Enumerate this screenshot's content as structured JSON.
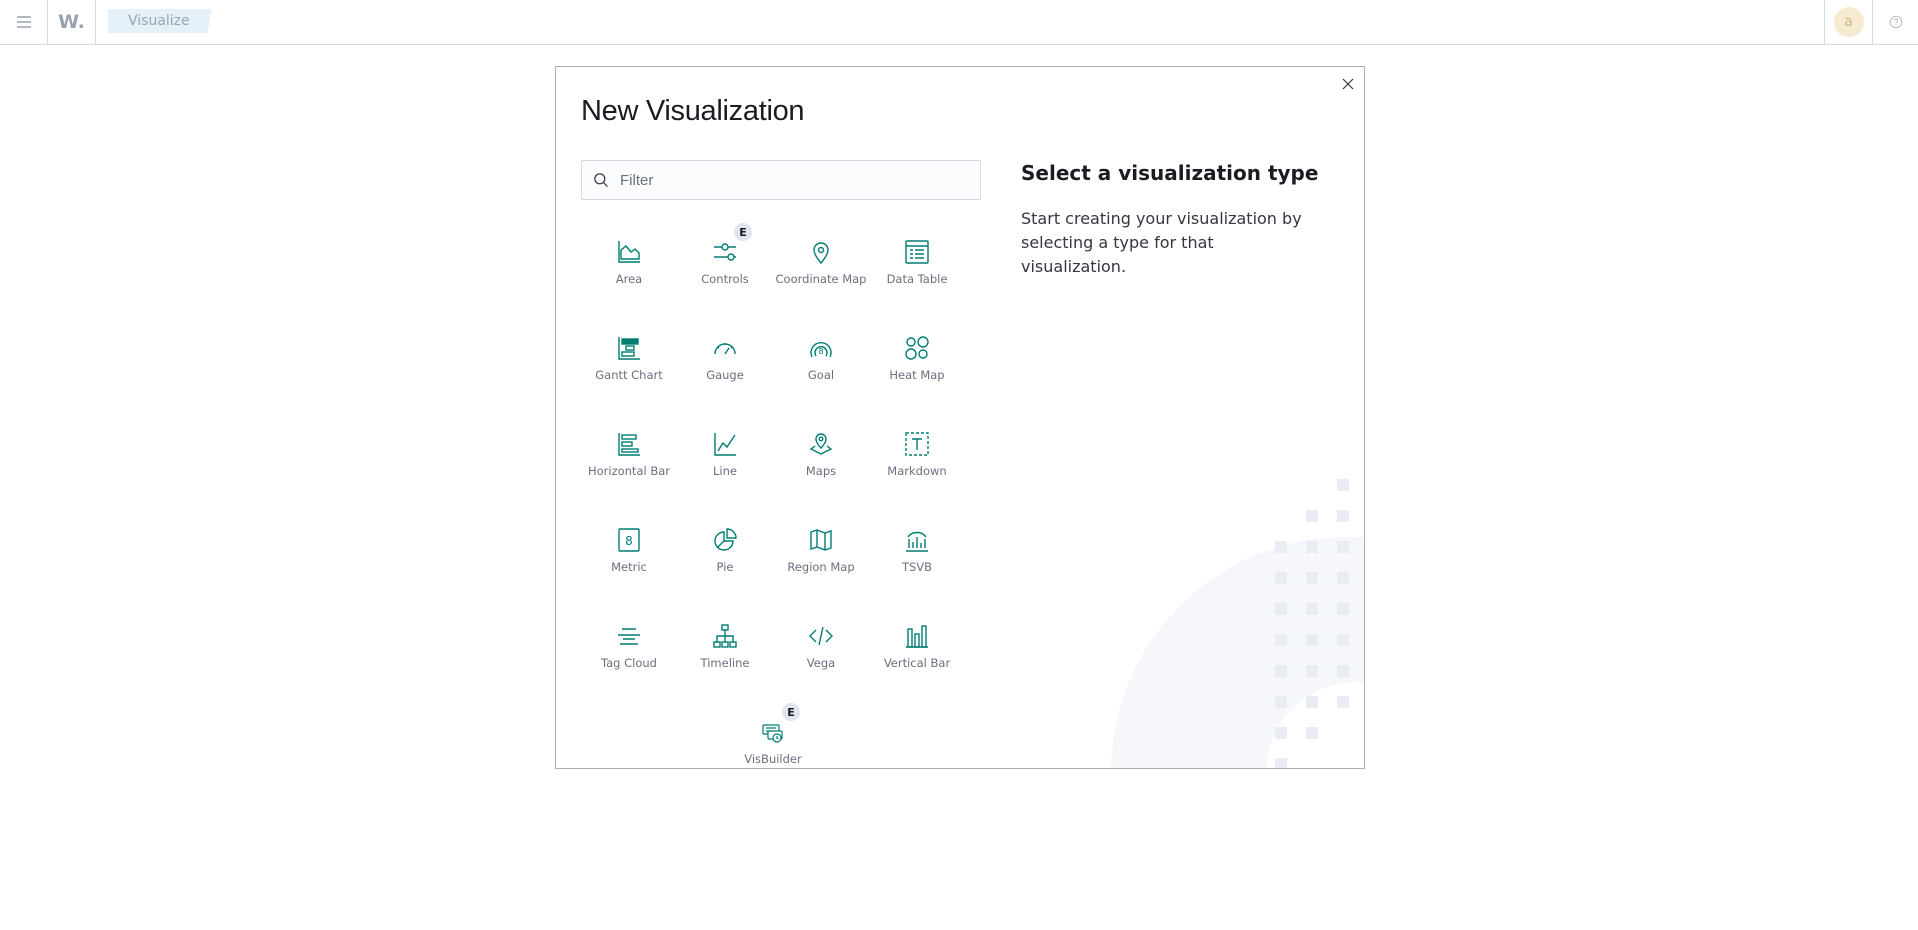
{
  "header": {
    "logo_text": "W.",
    "breadcrumb": "Visualize",
    "avatar_initial": "a",
    "icons": {
      "menu": "hamburger-icon",
      "help": "help-icon"
    }
  },
  "modal": {
    "title": "New Visualization",
    "search_placeholder": "Filter",
    "search_value": "",
    "description_title": "Select a visualization type",
    "description_text": "Start creating your visualization by selecting a type for that visualization.",
    "icons": {
      "close": "close-icon",
      "search": "search-icon"
    },
    "badge_text": "E",
    "types": [
      {
        "label": "Area",
        "icon": "area-chart-icon"
      },
      {
        "label": "Controls",
        "icon": "controls-icon"
      },
      {
        "label": "Coordinate Map",
        "icon": "map-marker-icon"
      },
      {
        "label": "Data Table",
        "icon": "table-icon"
      },
      {
        "label": "Gantt Chart",
        "icon": "gantt-chart-icon"
      },
      {
        "label": "Gauge",
        "icon": "gauge-icon"
      },
      {
        "label": "Goal",
        "icon": "goal-icon"
      },
      {
        "label": "Heat Map",
        "icon": "heat-map-icon"
      },
      {
        "label": "Horizontal Bar",
        "icon": "horizontal-bar-icon"
      },
      {
        "label": "Line",
        "icon": "line-chart-icon"
      },
      {
        "label": "Maps",
        "icon": "maps-icon"
      },
      {
        "label": "Markdown",
        "icon": "markdown-icon"
      },
      {
        "label": "Metric",
        "icon": "metric-icon"
      },
      {
        "label": "Pie",
        "icon": "pie-chart-icon"
      },
      {
        "label": "Region Map",
        "icon": "region-map-icon"
      },
      {
        "label": "TSVB",
        "icon": "tsvb-icon"
      },
      {
        "label": "Tag Cloud",
        "icon": "tag-cloud-icon"
      },
      {
        "label": "Timeline",
        "icon": "timeline-icon"
      },
      {
        "label": "Vega",
        "icon": "code-icon"
      },
      {
        "label": "Vertical Bar",
        "icon": "vertical-bar-icon"
      },
      {
        "label": "VisBuilder",
        "icon": "visbuilder-icon"
      }
    ]
  },
  "colors": {
    "accent": "#017d73",
    "muted_text": "#69707d",
    "border": "#d3dae6",
    "badge_bg": "#e0e5ee"
  }
}
